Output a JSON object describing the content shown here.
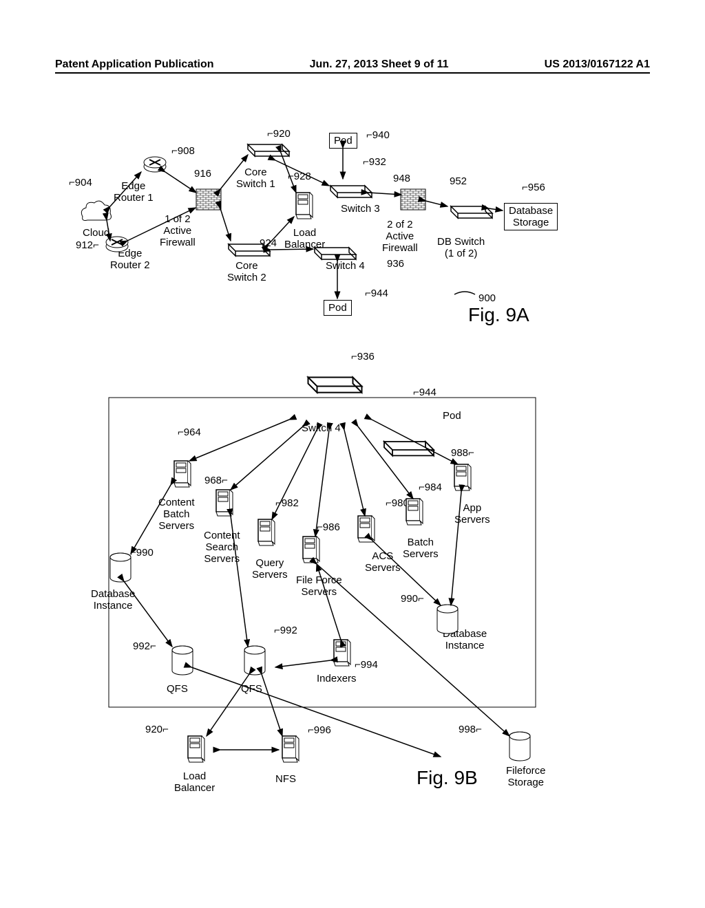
{
  "header": {
    "left": "Patent Application Publication",
    "mid": "Jun. 27, 2013  Sheet 9 of 11",
    "right": "US 2013/0167122 A1"
  },
  "figA": {
    "label": "Fig. 9A",
    "ref": "900",
    "nodes": {
      "cloud": {
        "ref": "904",
        "label": "Cloud"
      },
      "edgeRouter1": {
        "ref": "908",
        "label": "Edge\nRouter 1"
      },
      "edgeRouter2": {
        "ref": "912",
        "label": "Edge\nRouter 2"
      },
      "activeFirewall1": {
        "ref": "916",
        "label": "1 of 2\nActive\nFirewall"
      },
      "coreSwitch1": {
        "ref": "920",
        "label": "Core\nSwitch 1"
      },
      "coreSwitch2": {
        "ref": "924",
        "label": "Core\nSwitch 2"
      },
      "loadBalancer": {
        "ref": "928",
        "label": "Load\nBalancer"
      },
      "switch3": {
        "ref": "932",
        "label": "Switch 3"
      },
      "switch4": {
        "ref": "936",
        "label": "Switch 4"
      },
      "pod1": {
        "ref": "940",
        "label": "Pod"
      },
      "pod2": {
        "ref": "944",
        "label": "Pod"
      },
      "activeFirewall2": {
        "ref": "948",
        "label": "2 of 2\nActive\nFirewall"
      },
      "dbSwitch": {
        "ref": "952",
        "label": "DB Switch\n(1 of 2)"
      },
      "dbStorage": {
        "ref": "956",
        "label": "Database\nStorage"
      }
    }
  },
  "figB": {
    "label": "Fig. 9B",
    "nodes": {
      "switch4": {
        "ref": "936",
        "label": "Switch 4"
      },
      "pod": {
        "ref": "944",
        "label": "Pod"
      },
      "contentBatch": {
        "ref": "964",
        "label": "Content\nBatch\nServers"
      },
      "contentSearch": {
        "ref": "968",
        "label": "Content\nSearch\nServers"
      },
      "ACS": {
        "ref": "980",
        "label": "ACS\nServers"
      },
      "query": {
        "ref": "982",
        "label": "Query\nServers"
      },
      "batch": {
        "ref": "984",
        "label": "Batch\nServers"
      },
      "fileForce": {
        "ref": "986",
        "label": "File Force\nServers"
      },
      "app": {
        "ref": "988",
        "label": "App\nServers"
      },
      "dbInstanceL": {
        "ref": "990",
        "label": "Database\nInstance"
      },
      "dbInstanceR": {
        "ref": "990",
        "label": "Database\nInstance"
      },
      "qfsL": {
        "ref": "992",
        "label": "QFS"
      },
      "qfsM": {
        "ref": "992",
        "label": "QFS"
      },
      "indexers": {
        "ref": "994",
        "label": "Indexers"
      },
      "loadBalancer": {
        "ref": "920",
        "label": "Load\nBalancer"
      },
      "nfs": {
        "ref": "996",
        "label": "NFS"
      },
      "fileforceStorage": {
        "ref": "998",
        "label": "Fileforce\nStorage"
      }
    }
  }
}
